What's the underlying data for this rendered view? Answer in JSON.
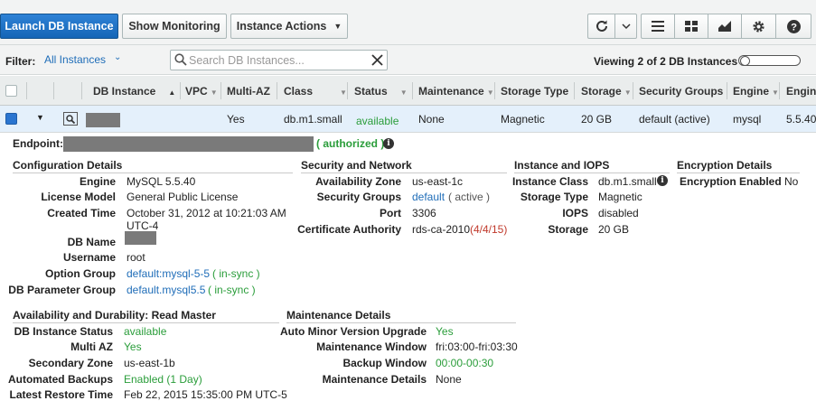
{
  "toolbar": {
    "launch_label": "Launch DB Instance",
    "monitoring_label": "Show Monitoring",
    "actions_label": "Instance Actions",
    "icons": [
      "refresh-icon",
      "chevron-down-icon",
      "list-view-icon",
      "grid-view-icon",
      "chart-icon",
      "gear-icon",
      "help-icon"
    ]
  },
  "filter": {
    "label": "Filter:",
    "value": "All Instances",
    "search_placeholder": "Search DB Instances...",
    "viewing": "Viewing 2 of 2 DB Instances"
  },
  "columns": [
    "DB Instance",
    "VPC",
    "Multi-AZ",
    "Class",
    "Status",
    "Maintenance",
    "Storage Type",
    "Storage",
    "Security Groups",
    "Engine",
    "Engin"
  ],
  "row": {
    "multi_az": "Yes",
    "class": "db.m1.small",
    "status": "available",
    "maintenance": "None",
    "storage_type": "Magnetic",
    "storage": "20 GB",
    "security_groups": "default (active)",
    "engine": "mysql",
    "engine_version": "5.5.40"
  },
  "endpoint": {
    "label": "Endpoint:",
    "status": "( authorized )"
  },
  "config": {
    "title": "Configuration Details",
    "engine_k": "Engine",
    "engine_v": "MySQL 5.5.40",
    "license_k": "License Model",
    "license_v": "General Public License",
    "created_k": "Created Time",
    "created_v1": "October 31, 2012 at 10:21:03 AM",
    "created_v2": "UTC-4",
    "dbname_k": "DB Name",
    "username_k": "Username",
    "username_v": "root",
    "option_k": "Option Group",
    "option_link": "default:mysql-5-5",
    "option_status": "( in-sync )",
    "param_k": "DB Parameter Group",
    "param_link": "default.mysql5.5",
    "param_status": "( in-sync )"
  },
  "security": {
    "title": "Security and Network",
    "az_k": "Availability Zone",
    "az_v": "us-east-1c",
    "sg_k": "Security Groups",
    "sg_link": "default",
    "sg_status": "( active )",
    "port_k": "Port",
    "port_v": "3306",
    "ca_k": "Certificate Authority",
    "ca_v": "rds-ca-2010",
    "ca_date": "(4/4/15)"
  },
  "iops": {
    "title": "Instance and IOPS",
    "class_k": "Instance Class",
    "class_v": "db.m1.small",
    "stype_k": "Storage Type",
    "stype_v": "Magnetic",
    "iops_k": "IOPS",
    "iops_v": "disabled",
    "storage_k": "Storage",
    "storage_v": "20 GB"
  },
  "encryption": {
    "title": "Encryption Details",
    "enabled_k": "Encryption Enabled",
    "enabled_v": "No"
  },
  "availability": {
    "title": "Availability and Durability: Read Master",
    "status_k": "DB Instance Status",
    "status_v": "available",
    "multiaz_k": "Multi AZ",
    "multiaz_v": "Yes",
    "secaz_k": "Secondary Zone",
    "secaz_v": "us-east-1b",
    "backup_k": "Automated Backups",
    "backup_v": "Enabled (1 Day)",
    "restore_k": "Latest Restore Time",
    "restore_v": "Feb 22, 2015 15:35:00 PM UTC-5"
  },
  "maintenance": {
    "title": "Maintenance Details",
    "auto_k": "Auto Minor Version Upgrade",
    "auto_v": "Yes",
    "window_k": "Maintenance Window",
    "window_v": "fri:03:00-fri:03:30",
    "bwindow_k": "Backup Window",
    "bwindow_v": "00:00-00:30",
    "details_k": "Maintenance Details",
    "details_v": "None"
  },
  "colors": {
    "primary": "#1565b6",
    "link": "#1f6db8",
    "ok": "#2a9d3a",
    "warn": "#c0392b",
    "row_selected": "#e4f0fb"
  }
}
